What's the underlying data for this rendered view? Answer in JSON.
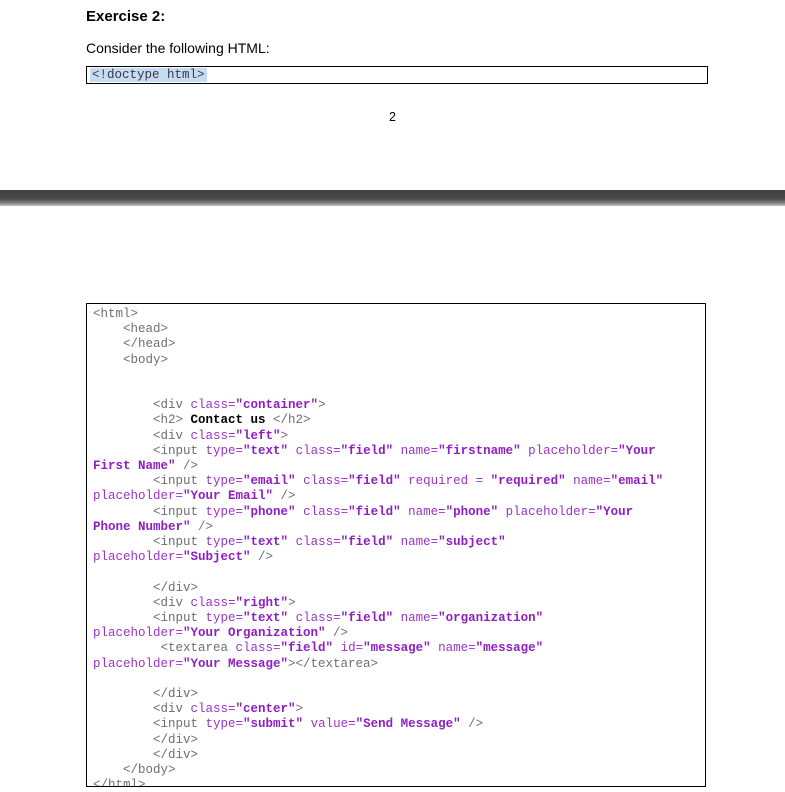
{
  "page1": {
    "heading": "Exercise 2:",
    "intro": "Consider the following HTML:",
    "doctype": "<!doctype html>",
    "page_number": "2"
  },
  "code": {
    "lines": [
      [
        [
          "tag",
          "<html>"
        ]
      ],
      [
        [
          "tag",
          "    <head>"
        ]
      ],
      [
        [
          "tag",
          "    </head>"
        ]
      ],
      [
        [
          "tag",
          "    <body>"
        ]
      ],
      [],
      [],
      [
        [
          "tag",
          "        <div "
        ],
        [
          "attr",
          "class="
        ],
        [
          "val",
          "\"container\""
        ],
        [
          "tag",
          ">"
        ]
      ],
      [
        [
          "tag",
          "        <h2> "
        ],
        [
          "text",
          "Contact us"
        ],
        [
          "tag",
          " </h2>"
        ]
      ],
      [
        [
          "tag",
          "        <div "
        ],
        [
          "attr",
          "class="
        ],
        [
          "val",
          "\"left\""
        ],
        [
          "tag",
          ">"
        ]
      ],
      [
        [
          "tag",
          "        <input "
        ],
        [
          "attr",
          "type="
        ],
        [
          "val",
          "\"text\""
        ],
        [
          "attr",
          " class="
        ],
        [
          "val",
          "\"field\""
        ],
        [
          "attr",
          " name="
        ],
        [
          "val",
          "\"firstname\""
        ],
        [
          "attr",
          " placeholder="
        ],
        [
          "val",
          "\"Your"
        ]
      ],
      [
        [
          "val",
          "First Name\""
        ],
        [
          "tag",
          " />"
        ]
      ],
      [
        [
          "tag",
          "        <input "
        ],
        [
          "attr",
          "type="
        ],
        [
          "val",
          "\"email\""
        ],
        [
          "attr",
          " class="
        ],
        [
          "val",
          "\"field\""
        ],
        [
          "attr",
          " required = "
        ],
        [
          "val",
          "\"required\""
        ],
        [
          "attr",
          " name="
        ],
        [
          "val",
          "\"email\""
        ]
      ],
      [
        [
          "attr",
          "placeholder="
        ],
        [
          "val",
          "\"Your Email\""
        ],
        [
          "tag",
          " />"
        ]
      ],
      [
        [
          "tag",
          "        <input "
        ],
        [
          "attr",
          "type="
        ],
        [
          "val",
          "\"phone\""
        ],
        [
          "attr",
          " class="
        ],
        [
          "val",
          "\"field\""
        ],
        [
          "attr",
          " name="
        ],
        [
          "val",
          "\"phone\""
        ],
        [
          "attr",
          " placeholder="
        ],
        [
          "val",
          "\"Your"
        ]
      ],
      [
        [
          "val",
          "Phone Number\""
        ],
        [
          "tag",
          " />"
        ]
      ],
      [
        [
          "tag",
          "        <input "
        ],
        [
          "attr",
          "type="
        ],
        [
          "val",
          "\"text\""
        ],
        [
          "attr",
          " class="
        ],
        [
          "val",
          "\"field\""
        ],
        [
          "attr",
          " name="
        ],
        [
          "val",
          "\"subject\""
        ]
      ],
      [
        [
          "attr",
          "placeholder="
        ],
        [
          "val",
          "\"Subject\""
        ],
        [
          "tag",
          " />"
        ]
      ],
      [],
      [
        [
          "tag",
          "        </div>"
        ]
      ],
      [
        [
          "tag",
          "        <div "
        ],
        [
          "attr",
          "class="
        ],
        [
          "val",
          "\"right\""
        ],
        [
          "tag",
          ">"
        ]
      ],
      [
        [
          "tag",
          "        <input "
        ],
        [
          "attr",
          "type="
        ],
        [
          "val",
          "\"text\""
        ],
        [
          "attr",
          " class="
        ],
        [
          "val",
          "\"field\""
        ],
        [
          "attr",
          " name="
        ],
        [
          "val",
          "\"organization\""
        ]
      ],
      [
        [
          "attr",
          "placeholder="
        ],
        [
          "val",
          "\"Your Organization\""
        ],
        [
          "tag",
          " />"
        ]
      ],
      [
        [
          "tag",
          "         <textarea "
        ],
        [
          "attr",
          "class="
        ],
        [
          "val",
          "\"field\""
        ],
        [
          "attr",
          " id="
        ],
        [
          "val",
          "\"message\""
        ],
        [
          "attr",
          " name="
        ],
        [
          "val",
          "\"message\""
        ]
      ],
      [
        [
          "attr",
          "placeholder="
        ],
        [
          "val",
          "\"Your Message\""
        ],
        [
          "tag",
          "></textarea>"
        ]
      ],
      [],
      [
        [
          "tag",
          "        </div>"
        ]
      ],
      [
        [
          "tag",
          "        <div "
        ],
        [
          "attr",
          "class="
        ],
        [
          "val",
          "\"center\""
        ],
        [
          "tag",
          ">"
        ]
      ],
      [
        [
          "tag",
          "        <input "
        ],
        [
          "attr",
          "type="
        ],
        [
          "val",
          "\"submit\""
        ],
        [
          "attr",
          " value="
        ],
        [
          "val",
          "\"Send Message\""
        ],
        [
          "tag",
          " />"
        ]
      ],
      [
        [
          "tag",
          "        </div>"
        ]
      ],
      [
        [
          "tag",
          "        </div>"
        ]
      ],
      [
        [
          "tag",
          "    </body>"
        ]
      ],
      [
        [
          "tag",
          "</html>"
        ]
      ]
    ]
  }
}
